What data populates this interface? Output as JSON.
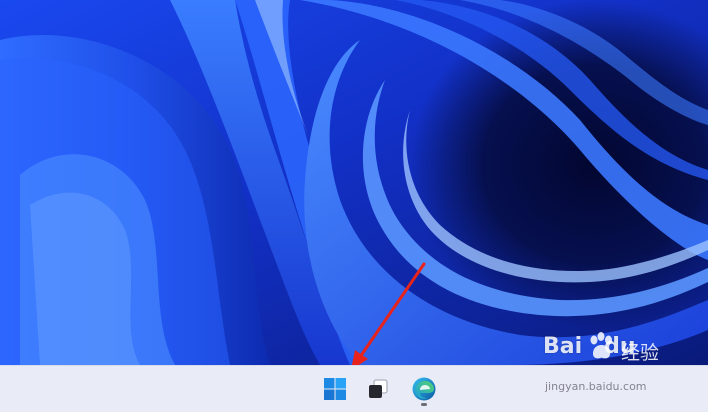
{
  "desktop": {
    "wallpaper_name": "windows-11-bloom-wallpaper",
    "colors": {
      "deep": "#050c4a",
      "mid": "#1637d8",
      "bright": "#3d7bff",
      "highlight": "#8fb8ff"
    }
  },
  "taskbar": {
    "background": "#e9ecf6",
    "items": [
      {
        "id": "start",
        "icon": "windows-logo-icon"
      },
      {
        "id": "task-view",
        "icon": "task-view-icon"
      },
      {
        "id": "edge",
        "icon": "edge-browser-icon",
        "running": true
      }
    ]
  },
  "annotation": {
    "arrow_color": "#e8231b",
    "arrow_target": "start"
  },
  "watermark": {
    "brand_part1": "Bai",
    "brand_part2": "du",
    "cn_text": "经验",
    "url": "jingyan.baidu.com"
  }
}
